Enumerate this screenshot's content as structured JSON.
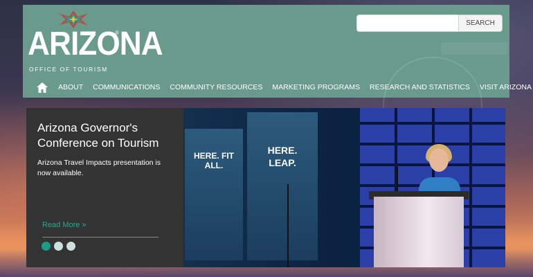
{
  "header": {
    "logo": {
      "word": "ARIZONA",
      "subtitle": "OFFICE OF TOURISM",
      "registered": "®"
    },
    "search": {
      "placeholder": "",
      "button_label": "SEARCH"
    },
    "nav": [
      {
        "label": "ABOUT"
      },
      {
        "label": "COMMUNICATIONS"
      },
      {
        "label": "COMMUNITY RESOURCES"
      },
      {
        "label": "MARKETING PROGRAMS"
      },
      {
        "label": "RESEARCH AND STATISTICS"
      },
      {
        "label": "VISIT ARIZONA"
      }
    ]
  },
  "hero": {
    "title": "Arizona Governor's Conference on Tourism",
    "body": "Arizona Travel Impacts presentation is now available.",
    "read_more": "Read More »",
    "slides": [
      {
        "active": true
      },
      {
        "active": false
      },
      {
        "active": false
      }
    ],
    "poster_texts": [
      "HERE. FIT ALL.",
      "HERE. LEAP."
    ]
  },
  "colors": {
    "header_bg": "#6a9a8c",
    "panel_bg": "#333333",
    "accent": "#1c9c88",
    "link": "#2fa78d"
  }
}
